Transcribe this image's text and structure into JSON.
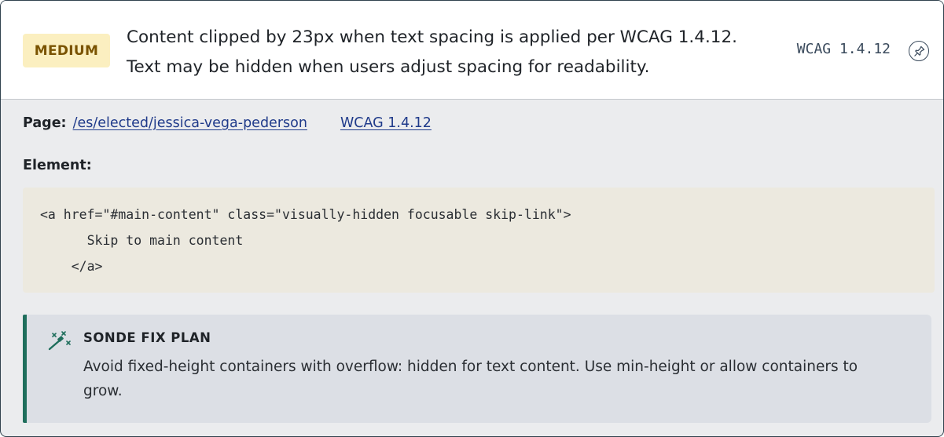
{
  "issue": {
    "severity": "MEDIUM",
    "description": "Content clipped by 23px when text spacing is applied per WCAG 1.4.12. Text may be hidden when users adjust spacing for readability.",
    "wcag_tag": "WCAG 1.4.12",
    "pin_icon": "pin-icon"
  },
  "details": {
    "page_label": "Page:",
    "page_link": "/es/elected/jessica-vega-pederson",
    "wcag_link": "WCAG 1.4.12",
    "element_label": "Element:"
  },
  "code": {
    "snippet": "<a href=\"#main-content\" class=\"visually-hidden focusable skip-link\">\n      Skip to main content\n    </a>"
  },
  "fix_plan": {
    "icon": "magic-wand-icon",
    "title": "SONDE FIX PLAN",
    "text": "Avoid fixed-height containers with overflow: hidden for text content. Use min-height or allow containers to grow."
  },
  "colors": {
    "severity_bg": "#fbefc0",
    "severity_text": "#7a5300",
    "link": "#1f3a8a",
    "fix_accent": "#1f6e5c",
    "code_bg": "#ece9df"
  }
}
